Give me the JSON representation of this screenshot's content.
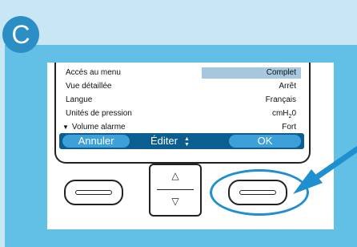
{
  "badge": {
    "letter": "C"
  },
  "menu": {
    "rows": [
      {
        "label": "Accés au menu",
        "value": "Complet"
      },
      {
        "label": "Vue détaillée",
        "value": "Arrêt"
      },
      {
        "label": "Langue",
        "value": "Français"
      },
      {
        "label": "Unités de pression",
        "value_pre": "cmH",
        "value_sub": "2",
        "value_post": "0"
      },
      {
        "label": "Volume alarme",
        "value": "Fort"
      }
    ]
  },
  "softkeys": {
    "left": "Annuler",
    "middle": "Éditer",
    "right": "OK"
  },
  "icons": {
    "scroll_arrow": "triangle-down",
    "updown": "up-down-arrows",
    "nav_up": "triangle-up-outline",
    "nav_down": "triangle-down-outline",
    "pointer": "arrow"
  },
  "colors": {
    "background": "#c9e6f5",
    "frame": "#62c0e6",
    "badge": "#2b8ec4",
    "softbar": "#0c5e90",
    "softkey": "#3ea0d8",
    "selection": "#a6c8de",
    "highlight": "#1f8fcf"
  }
}
